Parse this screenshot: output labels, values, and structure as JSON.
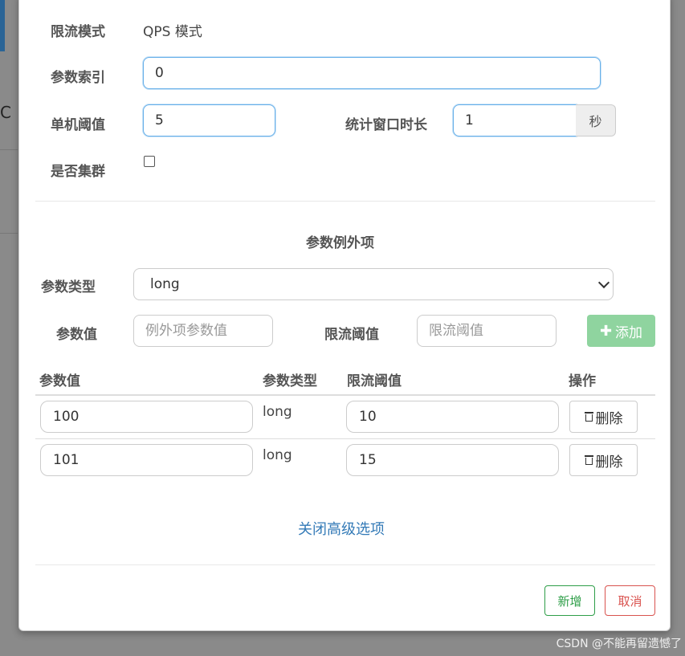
{
  "form": {
    "mode_label": "限流模式",
    "mode_value": "QPS 模式",
    "param_index_label": "参数索引",
    "param_index_value": "0",
    "threshold_label": "单机阈值",
    "threshold_value": "5",
    "window_label": "统计窗口时长",
    "window_value": "1",
    "window_unit": "秒",
    "cluster_label": "是否集群",
    "cluster_checked": false
  },
  "exception": {
    "section_title": "参数例外项",
    "param_type_label": "参数类型",
    "param_type_selected": "long",
    "param_value_label": "参数值",
    "param_value_placeholder": "例外项参数值",
    "limit_label": "限流阈值",
    "limit_placeholder": "限流阈值",
    "add_label": "添加"
  },
  "table": {
    "headers": [
      "参数值",
      "参数类型",
      "限流阈值",
      "操作"
    ],
    "rows": [
      {
        "value": "100",
        "type": "long",
        "limit": "10",
        "action": "删除"
      },
      {
        "value": "101",
        "type": "long",
        "limit": "15",
        "action": "删除"
      }
    ]
  },
  "advanced_link": "关闭高级选项",
  "footer": {
    "new_label": "新增",
    "cancel_label": "取消"
  },
  "watermark": "CSDN @不能再留遗憾了",
  "colors": {
    "link": "#337ab7",
    "add_button": "#8fd49f",
    "ok": "#2e9e48",
    "cancel": "#d9534f"
  },
  "icons": {
    "add": "plus-icon",
    "delete": "trash-icon",
    "select": "chevron-down-icon"
  }
}
